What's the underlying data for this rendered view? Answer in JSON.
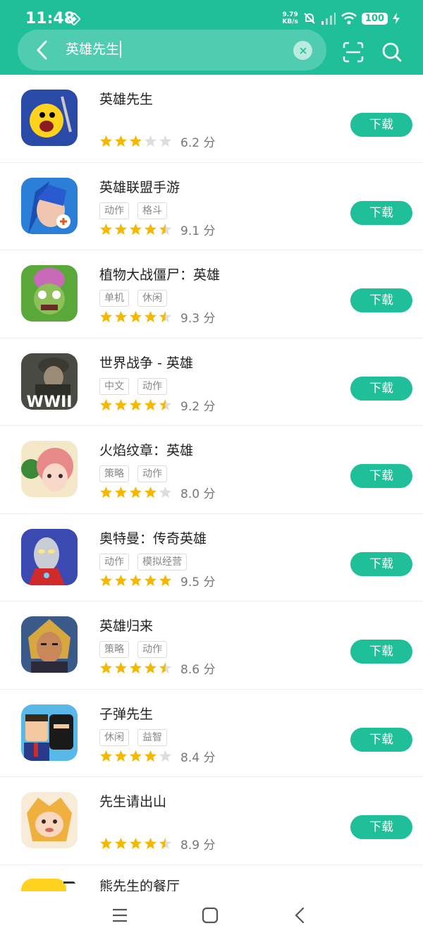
{
  "status": {
    "time": "11:48",
    "speed_value": "9.79",
    "speed_unit": "KB/s",
    "battery": "100"
  },
  "search": {
    "query": "英雄先生"
  },
  "colors": {
    "accent": "#1fbf9a",
    "star_on": "#f5b800",
    "star_off": "#dddddd"
  },
  "apps": [
    {
      "name": "英雄先生",
      "tags": [],
      "rating": 6.2,
      "score": "6.2 分",
      "button": "下载"
    },
    {
      "name": "英雄联盟手游",
      "tags": [
        "动作",
        "格斗"
      ],
      "rating": 9.1,
      "score": "9.1 分",
      "button": "下载"
    },
    {
      "name": "植物大战僵尸：英雄",
      "tags": [
        "单机",
        "休闲"
      ],
      "rating": 9.3,
      "score": "9.3 分",
      "button": "下载"
    },
    {
      "name": "世界战争 - 英雄",
      "tags": [
        "中文",
        "动作"
      ],
      "rating": 9.2,
      "score": "9.2 分",
      "button": "下载",
      "icon_text": "WWII"
    },
    {
      "name": "火焰纹章：英雄",
      "tags": [
        "策略",
        "动作"
      ],
      "rating": 8.0,
      "score": "8.0 分",
      "button": "下载"
    },
    {
      "name": "奥特曼：传奇英雄",
      "tags": [
        "动作",
        "模拟经营"
      ],
      "rating": 9.5,
      "score": "9.5 分",
      "button": "下载"
    },
    {
      "name": "英雄归来",
      "tags": [
        "策略",
        "动作"
      ],
      "rating": 8.6,
      "score": "8.6 分",
      "button": "下载"
    },
    {
      "name": "子弹先生",
      "tags": [
        "休闲",
        "益智"
      ],
      "rating": 8.4,
      "score": "8.4 分",
      "button": "下载"
    },
    {
      "name": "先生请出山",
      "tags": [],
      "rating": 8.9,
      "score": "8.9 分",
      "button": "下载"
    }
  ],
  "partial_app": {
    "name": "熊先生的餐厅"
  }
}
